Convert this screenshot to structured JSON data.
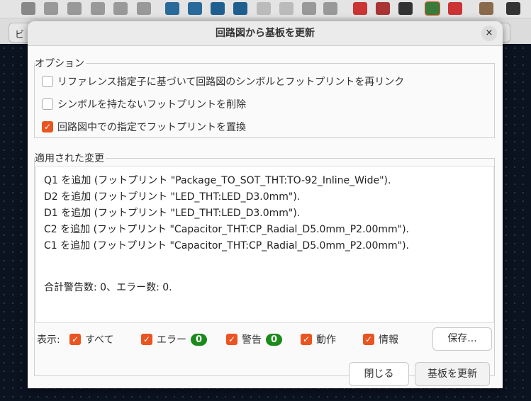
{
  "background": {
    "combo_left": "ビ"
  },
  "dialog": {
    "title": "回路図から基板を更新",
    "close_icon": "×",
    "options": {
      "label": "オプション",
      "items": [
        {
          "label": "リファレンス指定子に基づいて回路図のシンボルとフットプリントを再リンク",
          "checked": false
        },
        {
          "label": "シンボルを持たないフットプリントを削除",
          "checked": false
        },
        {
          "label": "回路図中での指定でフットプリントを置換",
          "checked": true
        }
      ]
    },
    "changes": {
      "label": "適用された変更",
      "lines": [
        "Q1 を追加 (フットプリント \"Package_TO_SOT_THT:TO-92_Inline_Wide\").",
        "D2 を追加 (フットプリント \"LED_THT:LED_D3.0mm\").",
        "D1 を追加 (フットプリント \"LED_THT:LED_D3.0mm\").",
        "C2 を追加 (フットプリント \"Capacitor_THT:CP_Radial_D5.0mm_P2.00mm\").",
        "C1 を追加 (フットプリント \"Capacitor_THT:CP_Radial_D5.0mm_P2.00mm\")."
      ],
      "summary": "合計警告数: 0、エラー数: 0."
    },
    "filter": {
      "label": "表示:",
      "all": "すべて",
      "errors": "エラー",
      "error_count": "0",
      "warnings": "警告",
      "warning_count": "0",
      "actions": "動作",
      "info": "情報",
      "save": "保存..."
    },
    "buttons": {
      "close": "閉じる",
      "update": "基板を更新"
    }
  }
}
